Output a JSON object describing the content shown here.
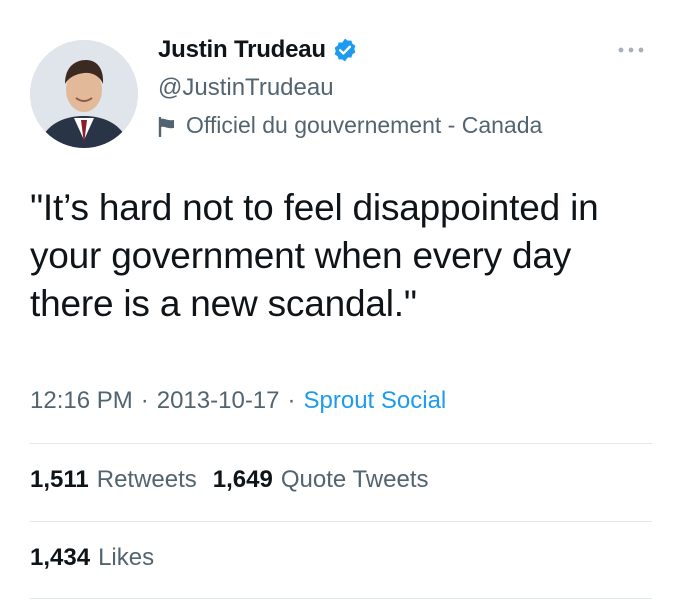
{
  "user": {
    "display_name": "Justin Trudeau",
    "handle": "@JustinTrudeau",
    "label": "Officiel du gouvernement - Canada",
    "verified_color": "#1d9bf0"
  },
  "tweet": {
    "text": "\"It’s hard not to feel disappointed in your government when every day there is a new scandal.\"",
    "time": "12:16 PM",
    "date": "2013-10-17",
    "separator": "·",
    "source": "Sprout Social"
  },
  "stats": {
    "retweets_count": "1,511",
    "retweets_label": "Retweets",
    "quote_count": "1,649",
    "quote_label": "Quote Tweets",
    "likes_count": "1,434",
    "likes_label": "Likes"
  },
  "icons": {
    "verified": "verified-badge-icon",
    "flag": "government-flag-icon",
    "more": "more-options-icon"
  },
  "colors": {
    "text": "#0f1419",
    "secondary": "#536471",
    "link": "#1d9bf0",
    "divider": "#e4e8eb"
  }
}
